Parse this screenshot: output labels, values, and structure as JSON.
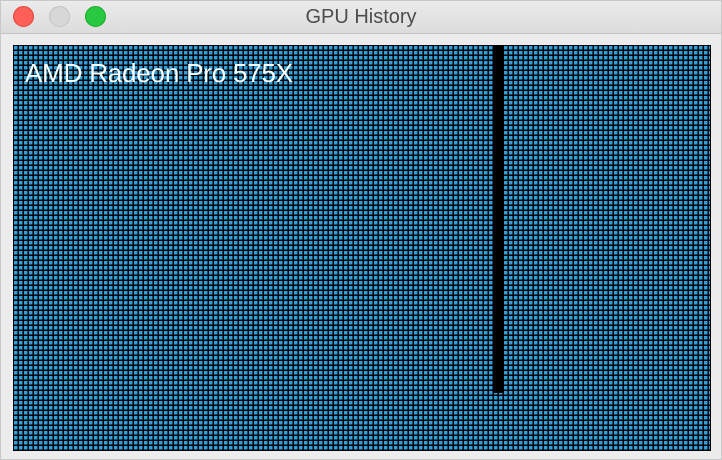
{
  "window": {
    "title": "GPU History"
  },
  "graph": {
    "gpu_name": "AMD Radeon Pro 575X",
    "usage_fraction": 0.86,
    "colors": {
      "grid_fill": "#2fa0db",
      "grid_lines": "#000000",
      "bar": "#000000",
      "label": "#ffffff"
    }
  },
  "titlebar_buttons": [
    {
      "name": "close",
      "color": "#fe5f57"
    },
    {
      "name": "minimize",
      "color": "#d7d7d7"
    },
    {
      "name": "zoom",
      "color": "#28c840"
    }
  ]
}
